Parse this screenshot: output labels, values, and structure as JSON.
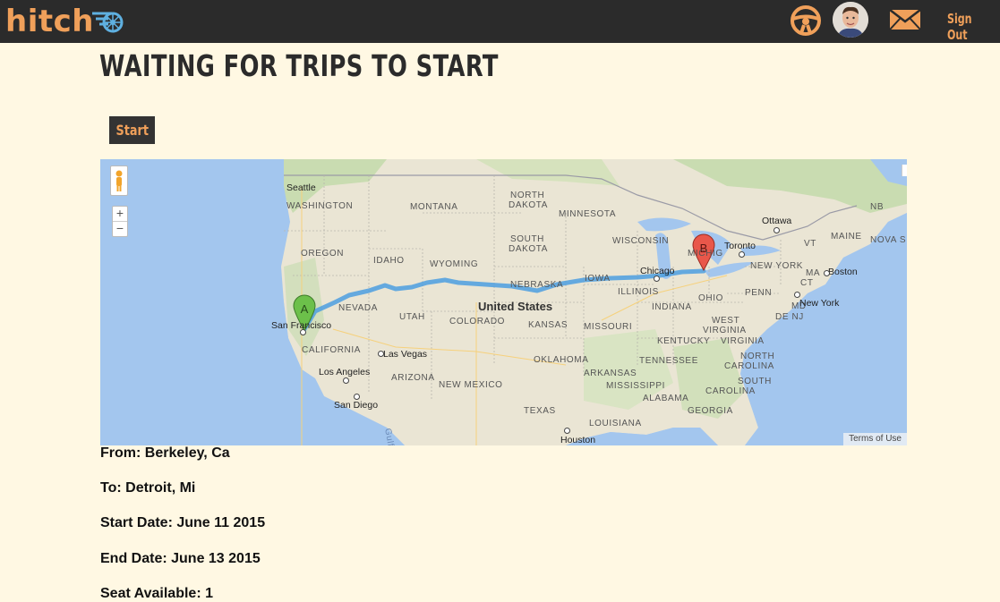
{
  "header": {
    "logo_text": "hitch",
    "signout_label": "Sign Out",
    "accent_color": "#f0a05a",
    "bar_color": "#2b2b2b"
  },
  "page": {
    "title": "WAITING FOR TRIPS TO START"
  },
  "actions": {
    "start_label": "Start"
  },
  "map": {
    "markers": [
      "A",
      "B"
    ],
    "terms_label": "Terms of Use",
    "labels": {
      "seattle": "Seattle",
      "washington": "WASHINGTON",
      "oregon": "OREGON",
      "idaho": "IDAHO",
      "montana": "MONTANA",
      "wyoming": "WYOMING",
      "north": "NORTH",
      "dakota": "DAKOTA",
      "south": "SOUTH",
      "dakota2": "DAKOTA",
      "minnesota": "MINNESOTA",
      "wisconsin": "WISCONSIN",
      "michigan": "MICHIG",
      "nevada": "NEVADA",
      "utah": "UTAH",
      "colorado": "COLORADO",
      "nebraska": "NEBRASKA",
      "iowa": "IOWA",
      "illinois": "ILLINOIS",
      "indiana": "INDIANA",
      "ohio": "OHIO",
      "kansas": "KANSAS",
      "missouri": "MISSOURI",
      "kentucky": "KENTUCKY",
      "tennessee": "TENNESSEE",
      "oklahoma": "OKLAHOMA",
      "arkansas": "ARKANSAS",
      "texas": "TEXAS",
      "new_mexico": "NEW MEXICO",
      "arizona": "ARIZONA",
      "california": "CALIFORNIA",
      "mississippi": "MISSISSIPPI",
      "alabama": "ALABAMA",
      "georgia": "GEORGIA",
      "louisiana": "LOUISIANA",
      "west": "WEST",
      "virginia_w": "VIRGINIA",
      "virginia": "VIRGINIA",
      "north_c": "NORTH",
      "carolina_n": "CAROLINA",
      "south_c": "SOUTH",
      "carolina_s": "CAROLINA",
      "penn": "PENN",
      "md": "MD",
      "denj": "DE NJ",
      "new_york_state": "NEW YORK",
      "vt": "VT",
      "maine": "MAINE",
      "nb": "NB",
      "nova": "NOVA S",
      "ma": "MA",
      "ct": "CT",
      "ottawa": "Ottawa",
      "toronto": "Toronto",
      "boston": "Boston",
      "new_york": "New York",
      "chicago": "Chicago",
      "san_francisco": "San Francisco",
      "las_vegas": "Las Vegas",
      "los_angeles": "Los Angeles",
      "san_diego": "San Diego",
      "houston": "Houston",
      "united_states": "United States",
      "gulf": "Gulf"
    }
  },
  "trip": {
    "from": "From: Berkeley, Ca",
    "to": "To: Detroit, Mi",
    "start_date": "Start Date: June 11 2015",
    "end_date": "End Date: June 13 2015",
    "seats": "Seat Available: 1"
  }
}
